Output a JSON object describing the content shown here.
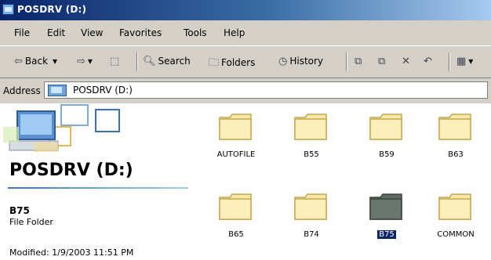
{
  "window": {
    "title": "POSDRV (D:)"
  },
  "menu": [
    "File",
    "Edit",
    "View",
    "Favorites",
    "Tools",
    "Help"
  ],
  "toolbar": {
    "back_label": "Back",
    "search_label": "Search",
    "folders_label": "Folders",
    "history_label": "History"
  },
  "address": {
    "label": "Address",
    "value": "POSDRV (D:)"
  },
  "info_panel": {
    "drive_title": "POSDRV (D:)",
    "selected_name": "B75",
    "selected_type": "File Folder",
    "selected_modified": "Modified: 1/9/2003 11:51 PM"
  },
  "folders": [
    {
      "name": "AUTOFILE",
      "selected": false
    },
    {
      "name": "B55",
      "selected": false
    },
    {
      "name": "B59",
      "selected": false
    },
    {
      "name": "B63",
      "selected": false
    },
    {
      "name": "B65",
      "selected": false
    },
    {
      "name": "B74",
      "selected": false
    },
    {
      "name": "B75",
      "selected": true
    },
    {
      "name": "COMMON",
      "selected": false
    }
  ],
  "colors": {
    "title_bar": "#0a246a",
    "folder_yellow": "#f8e7a6",
    "folder_selected": "#5f6b62",
    "selection": "#0a246a"
  }
}
